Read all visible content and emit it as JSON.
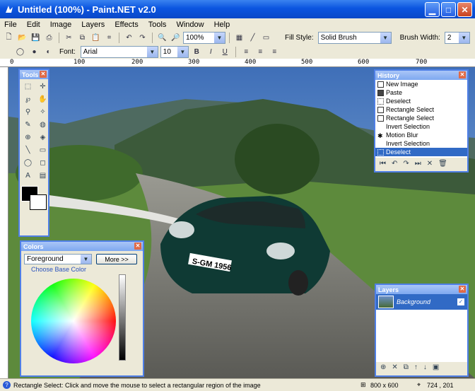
{
  "window": {
    "title": "Untitled (100%) - Paint.NET v2.0",
    "controls": [
      "_",
      "□",
      "✕"
    ]
  },
  "menu": [
    "File",
    "Edit",
    "Image",
    "Layers",
    "Effects",
    "Tools",
    "Window",
    "Help"
  ],
  "toolbar": {
    "zoom_value": "100%",
    "fill_style_label": "Fill Style:",
    "fill_style_value": "Solid Brush",
    "brush_width_label": "Brush Width:",
    "brush_width_value": "2"
  },
  "toolbar2": {
    "font_label": "Font:",
    "font_value": "Arial",
    "size_value": "10",
    "bold": "B",
    "italic": "I",
    "underline": "U"
  },
  "ruler": {
    "marks": [
      "0",
      "100",
      "200",
      "300",
      "400",
      "500",
      "600",
      "700"
    ]
  },
  "tools_panel": {
    "title": "Tools",
    "icons": [
      "rect-select",
      "move",
      "lasso",
      "pan",
      "zoom",
      "magic-wand",
      "pencil",
      "paint-bucket",
      "clone",
      "recolor",
      "line",
      "rectangle",
      "ellipse",
      "eraser",
      "text",
      "gradient"
    ]
  },
  "history": {
    "title": "History",
    "items": [
      "New Image",
      "Paste",
      "Deselect",
      "Rectangle Select",
      "Rectangle Select",
      "Invert Selection",
      "Motion Blur",
      "Invert Selection",
      "Deselect"
    ],
    "selected_index": 8
  },
  "colors": {
    "title": "Colors",
    "mode": "Foreground",
    "more_button": "More >>",
    "base_label": "Choose Base Color"
  },
  "layers": {
    "title": "Layers",
    "items": [
      "Background"
    ]
  },
  "status": {
    "text": "Rectangle Select: Click and move the mouse to select a rectangular region of the image",
    "image_size": "800 x 600",
    "cursor_pos": "724 , 201"
  },
  "colors_theme": {
    "xp_blue": "#0b55e0",
    "panel_border": "#4f7fe6",
    "selection": "#316ac5"
  }
}
